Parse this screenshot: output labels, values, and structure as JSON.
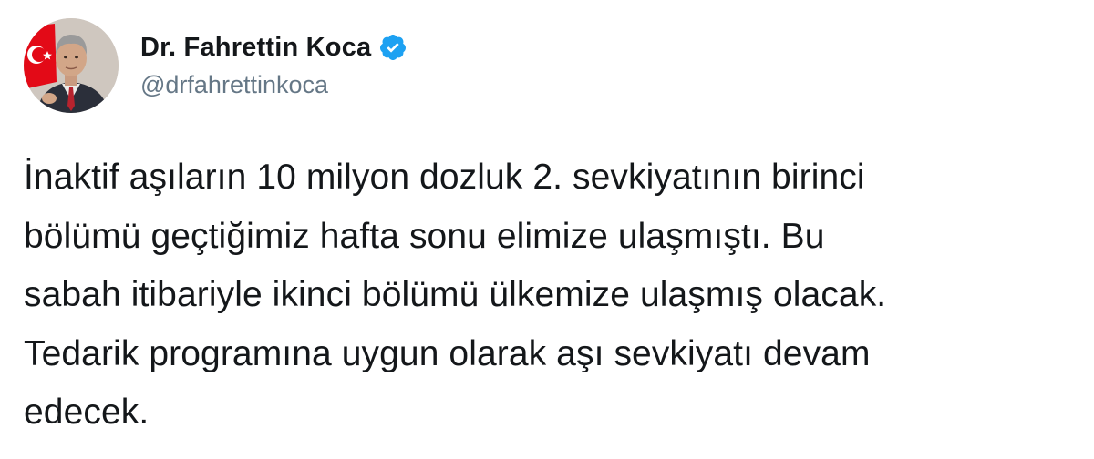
{
  "author": {
    "display_name": "Dr. Fahrettin Koca",
    "handle": "@drfahrettinkoca",
    "verified": true,
    "avatar_icon": "profile-photo",
    "verified_icon": "verified-badge-icon"
  },
  "tweet": {
    "text": "İnaktif aşıların 10 milyon dozluk 2. sevkiyatının birinci\nbölümü geçtiğimiz hafta sonu elimize ulaşmıştı. Bu\nsabah itibariyle ikinci bölümü ülkemize ulaşmış olacak.\nTedarik programına uygun olarak aşı sevkiyatı devam\nedecek."
  },
  "colors": {
    "text": "#14171a",
    "secondary": "#657786",
    "verified_blue": "#1da1f2",
    "flag_red": "#e30a17"
  }
}
